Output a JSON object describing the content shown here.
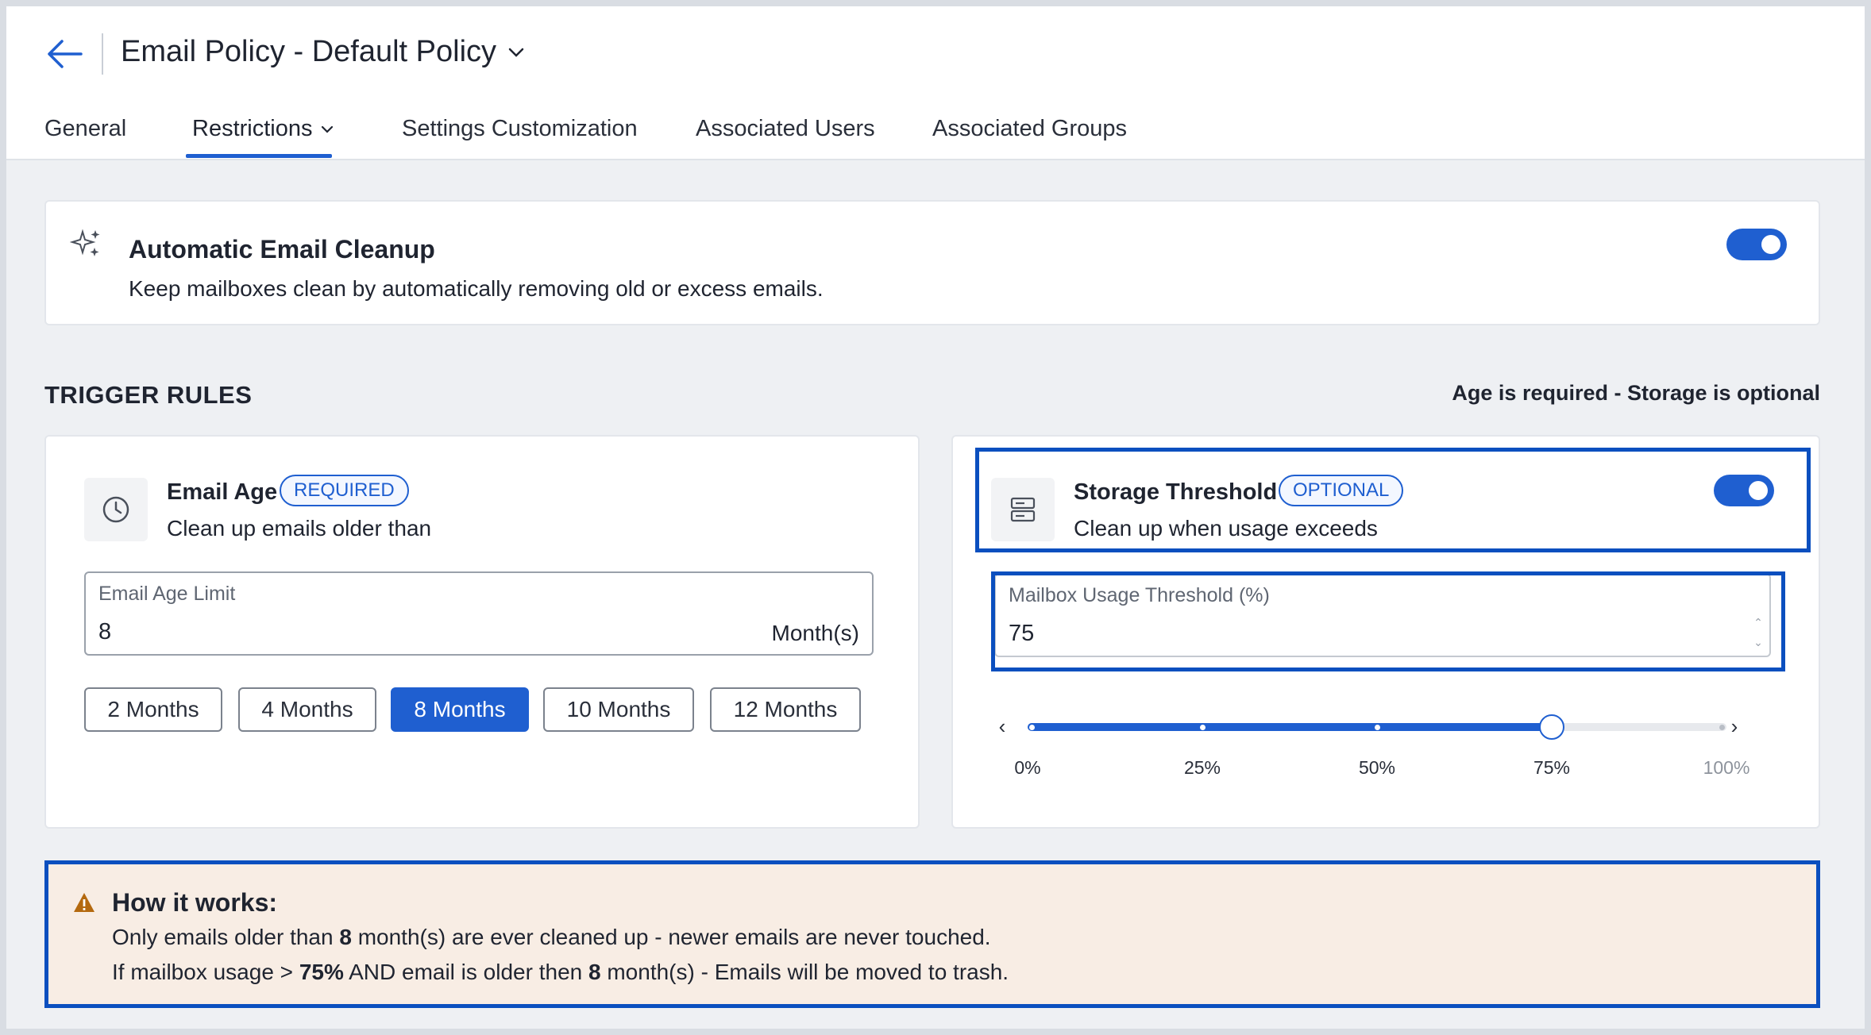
{
  "header": {
    "title": "Email Policy - Default Policy",
    "back_icon": "arrow-left-icon",
    "dropdown_icon": "chevron-down-icon"
  },
  "tabs": [
    {
      "label": "General",
      "active": false
    },
    {
      "label": "Restrictions",
      "active": true,
      "has_dropdown": true
    },
    {
      "label": "Settings Customization",
      "active": false
    },
    {
      "label": "Associated Users",
      "active": false
    },
    {
      "label": "Associated Groups",
      "active": false
    }
  ],
  "cleanup": {
    "icon": "sparkle-icon",
    "title": "Automatic Email Cleanup",
    "description": "Keep mailboxes clean by automatically removing old or excess emails.",
    "enabled": true
  },
  "trigger_rules": {
    "title": "TRIGGER RULES",
    "note": "Age is required - Storage is optional"
  },
  "email_age": {
    "icon": "clock-icon",
    "title": "Email Age",
    "badge": "REQUIRED",
    "description": "Clean up emails older than",
    "field_label": "Email Age Limit",
    "field_value": "8",
    "field_unit": "Month(s)",
    "presets": [
      "2 Months",
      "4 Months",
      "8 Months",
      "10 Months",
      "12 Months"
    ],
    "selected_preset": "8 Months"
  },
  "storage": {
    "icon": "server-icon",
    "title": "Storage Threshold",
    "badge": "OPTIONAL",
    "description": "Clean up when usage exceeds",
    "enabled": true,
    "field_label": "Mailbox Usage Threshold (%)",
    "field_value": "75",
    "slider_value": 75,
    "slider_ticks": [
      "0%",
      "25%",
      "50%",
      "75%",
      "100%"
    ]
  },
  "how_it_works": {
    "icon": "warning-icon",
    "title": "How it works:",
    "line1": {
      "a": "Only emails older than ",
      "b": "8",
      "c": " month(s) are ever cleaned up - newer emails are never touched."
    },
    "line2": {
      "a": "If mailbox usage > ",
      "b": "75%",
      "c": " AND email is older then ",
      "d": "8",
      "e": " month(s) - Emails will be moved to trash."
    }
  },
  "colors": {
    "accent": "#1f5fd0",
    "highlight_border": "#0b4fbf",
    "info_background": "#f8ede4",
    "warning": "#b4690e"
  }
}
